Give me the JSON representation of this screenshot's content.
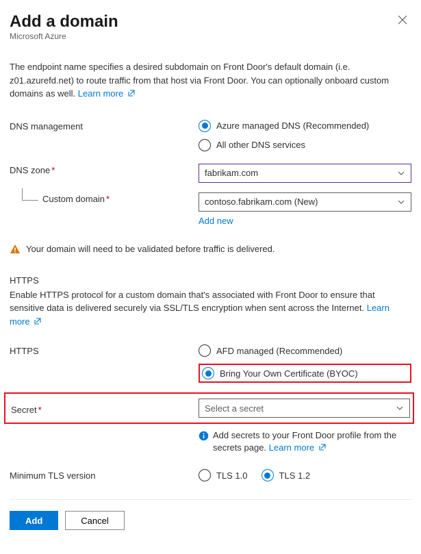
{
  "header": {
    "title": "Add a domain",
    "subtitle": "Microsoft Azure"
  },
  "intro": {
    "text": "The endpoint name specifies a desired subdomain on Front Door's default domain (i.e. z01.azurefd.net) to route traffic from that host via Front Door. You can optionally onboard custom domains as well. ",
    "learnMore": "Learn more"
  },
  "dns": {
    "managementLabel": "DNS management",
    "options": {
      "azure": "Azure managed DNS (Recommended)",
      "other": "All other DNS services"
    },
    "zoneLabel": "DNS zone",
    "zoneValue": "fabrikam.com",
    "customDomainLabel": "Custom domain",
    "customDomainValue": "contoso.fabrikam.com (New)",
    "addNew": "Add new"
  },
  "warning": "Your domain will need to be validated before traffic is delivered.",
  "https": {
    "heading": "HTTPS",
    "desc": "Enable HTTPS protocol for a custom domain that's associated with Front Door to ensure that sensitive data is delivered securely via SSL/TLS encryption when sent across the Internet. ",
    "learnMore": "Learn more",
    "label": "HTTPS",
    "options": {
      "managed": "AFD managed (Recommended)",
      "byoc": "Bring Your Own Certificate (BYOC)"
    }
  },
  "secret": {
    "label": "Secret",
    "placeholder": "Select a secret",
    "info": "Add secrets to your Front Door profile from the secrets page. ",
    "learnMore": "Learn more"
  },
  "tls": {
    "label": "Minimum TLS version",
    "options": {
      "tls10": "TLS 1.0",
      "tls12": "TLS 1.2"
    }
  },
  "footer": {
    "add": "Add",
    "cancel": "Cancel"
  }
}
